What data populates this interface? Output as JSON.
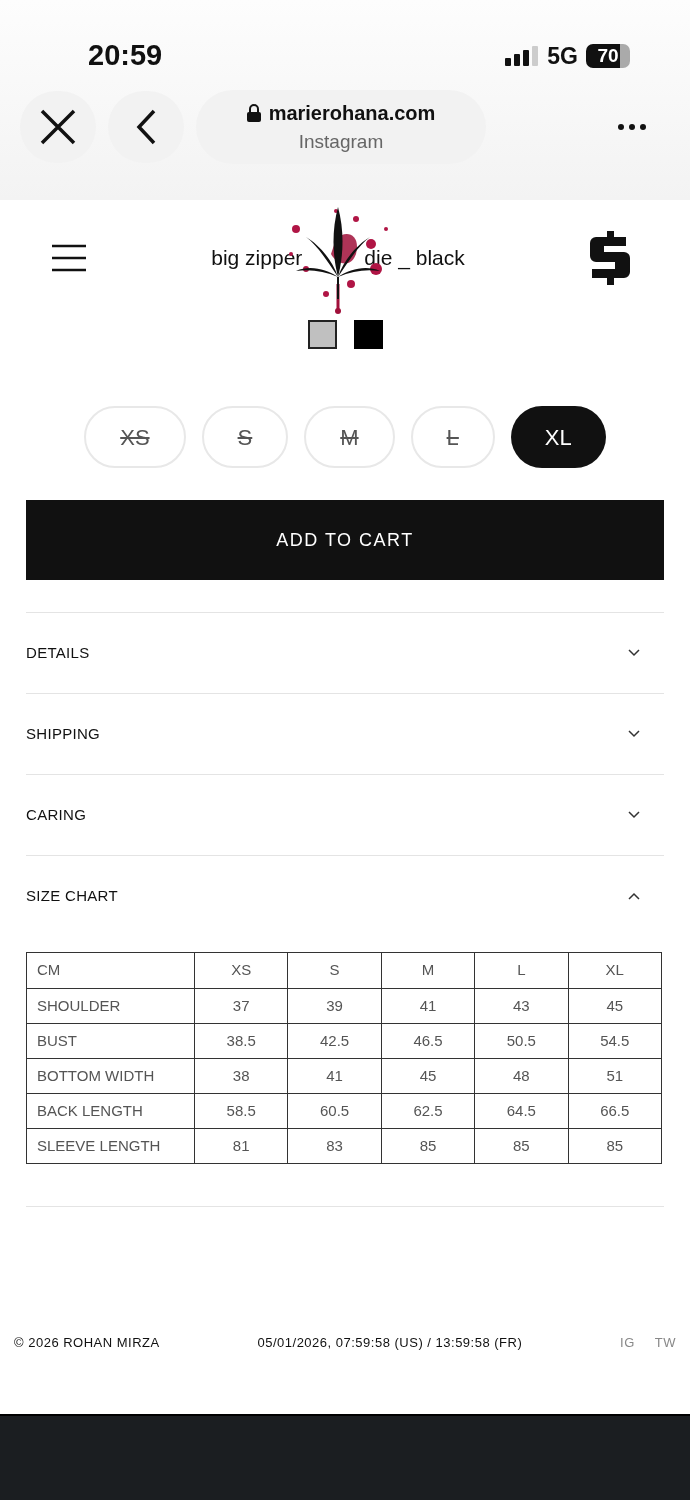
{
  "status_bar": {
    "time": "20:59",
    "network": "5G",
    "battery": "70"
  },
  "browser": {
    "domain": "marierohana.com",
    "source": "Instagram"
  },
  "header": {
    "title_left": "big zipper",
    "title_right": "die _ black"
  },
  "swatches": [
    {
      "color": "#c0c0c0",
      "selected": true
    },
    {
      "color": "#000000",
      "selected": false
    }
  ],
  "sizes": [
    {
      "label": "XS",
      "available": false,
      "selected": false
    },
    {
      "label": "S",
      "available": false,
      "selected": false
    },
    {
      "label": "M",
      "available": false,
      "selected": false
    },
    {
      "label": "L",
      "available": false,
      "selected": false
    },
    {
      "label": "XL",
      "available": true,
      "selected": true
    }
  ],
  "add_to_cart": "ADD TO CART",
  "sections": [
    {
      "title": "DETAILS",
      "expanded": false
    },
    {
      "title": "SHIPPING",
      "expanded": false
    },
    {
      "title": "CARING",
      "expanded": false
    },
    {
      "title": "SIZE CHART",
      "expanded": true
    }
  ],
  "size_chart": {
    "columns": [
      "CM",
      "XS",
      "S",
      "M",
      "L",
      "XL"
    ],
    "rows": [
      [
        "SHOULDER",
        "37",
        "39",
        "41",
        "43",
        "45"
      ],
      [
        "BUST",
        "38.5",
        "42.5",
        "46.5",
        "50.5",
        "54.5"
      ],
      [
        "BOTTOM WIDTH",
        "38",
        "41",
        "45",
        "48",
        "51"
      ],
      [
        "BACK LENGTH",
        "58.5",
        "60.5",
        "62.5",
        "64.5",
        "66.5"
      ],
      [
        "SLEEVE LENGTH",
        "81",
        "83",
        "85",
        "85",
        "85"
      ]
    ]
  },
  "footer": {
    "copyright": "© 2026 ROHAN MIRZA",
    "timestamp": "05/01/2026, 07:59:58 (US) / 13:59:58 (FR)",
    "links": [
      "IG",
      "TW"
    ]
  }
}
